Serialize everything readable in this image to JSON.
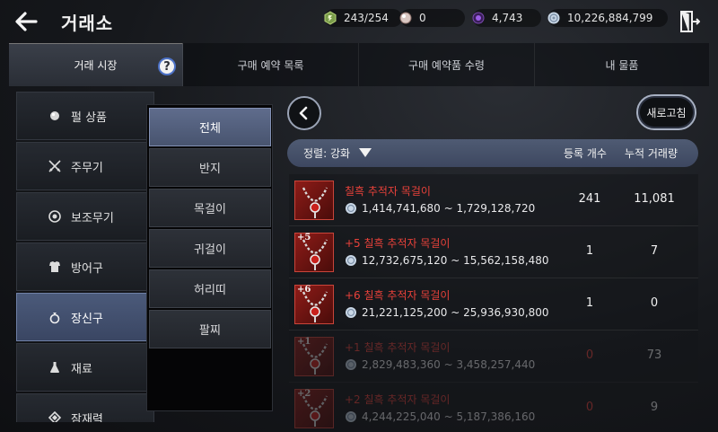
{
  "header": {
    "title": "거래소",
    "currencies": {
      "energy": "243/254",
      "pearl": "0",
      "black_stone": "4,743",
      "silver": "10,226,884,799"
    }
  },
  "tabs": [
    {
      "label": "거래 시장"
    },
    {
      "label": "구매 예약 목록"
    },
    {
      "label": "구매 예약품 수령"
    },
    {
      "label": "내 물품"
    }
  ],
  "categories": [
    {
      "label": "펄 상품",
      "icon": "pearl-icon"
    },
    {
      "label": "주무기",
      "icon": "crossed-swords-icon"
    },
    {
      "label": "보조무기",
      "icon": "shield-icon"
    },
    {
      "label": "방어구",
      "icon": "armor-icon"
    },
    {
      "label": "장신구",
      "icon": "ring-icon"
    },
    {
      "label": "재료",
      "icon": "flask-icon"
    },
    {
      "label": "잠재력",
      "icon": "potential-icon"
    }
  ],
  "subcategories": [
    {
      "label": "전체"
    },
    {
      "label": "반지"
    },
    {
      "label": "목걸이"
    },
    {
      "label": "귀걸이"
    },
    {
      "label": "허리띠"
    },
    {
      "label": "팔찌"
    }
  ],
  "toolbar": {
    "refresh_label": "새로고침",
    "sort_label": "정렬: 강화",
    "col_count": "등록 개수",
    "col_volume": "누적 거래량"
  },
  "items": [
    {
      "enhance": "",
      "name": "칠흑 추적자 목걸이",
      "price": "1,414,741,680 ~ 1,729,128,720",
      "count": "241",
      "volume": "11,081",
      "available": true
    },
    {
      "enhance": "+5",
      "name": "+5 칠흑 추적자 목걸이",
      "price": "12,732,675,120 ~ 15,562,158,480",
      "count": "1",
      "volume": "7",
      "available": true
    },
    {
      "enhance": "+6",
      "name": "+6 칠흑 추적자 목걸이",
      "price": "21,221,125,200 ~ 25,936,930,800",
      "count": "1",
      "volume": "0",
      "available": true
    },
    {
      "enhance": "+1",
      "name": "+1 칠흑 추적자 목걸이",
      "price": "2,829,483,360 ~ 3,458,257,440",
      "count": "0",
      "volume": "73",
      "available": false
    },
    {
      "enhance": "+2",
      "name": "+2 칠흑 추적자 목걸이",
      "price": "4,244,225,040 ~ 5,187,386,160",
      "count": "0",
      "volume": "9",
      "available": false
    }
  ],
  "colors": {
    "item_name_red": "#e8413a",
    "active_tab": "#3a3f49",
    "active_category": "#4b5a7a",
    "sort_bar": "#4f5b73"
  }
}
